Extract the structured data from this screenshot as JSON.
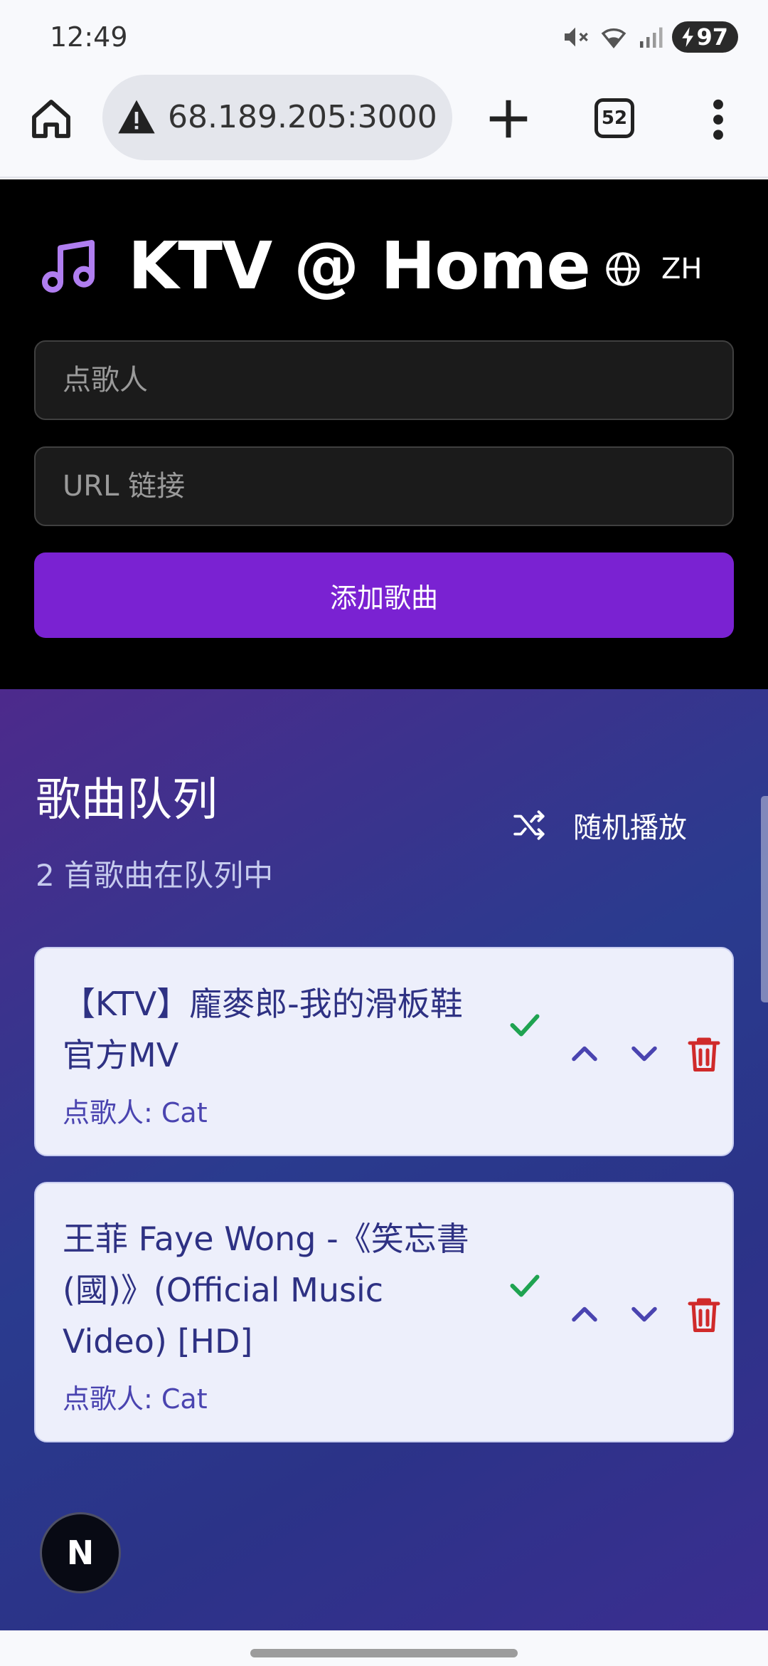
{
  "status_bar": {
    "time": "12:49",
    "battery": "97"
  },
  "browser": {
    "url": "68.189.205:3000",
    "tab_count": "52"
  },
  "header": {
    "title": "KTV @ Home",
    "language": "ZH",
    "singer_placeholder": "点歌人",
    "url_placeholder": "URL 链接",
    "add_button": "添加歌曲",
    "accent_color": "#7a22d2"
  },
  "queue": {
    "title": "歌曲队列",
    "count_text": "2 首歌曲在队列中",
    "shuffle_label": "随机播放",
    "items": [
      {
        "title": "【KTV】龐麥郎-我的滑板鞋官方MV",
        "singer": "点歌人: Cat"
      },
      {
        "title": "王菲 Faye Wong -《笑忘書(國)》(Official Music Video) [HD]",
        "singer": "点歌人: Cat"
      }
    ]
  },
  "floating_badge": "N"
}
